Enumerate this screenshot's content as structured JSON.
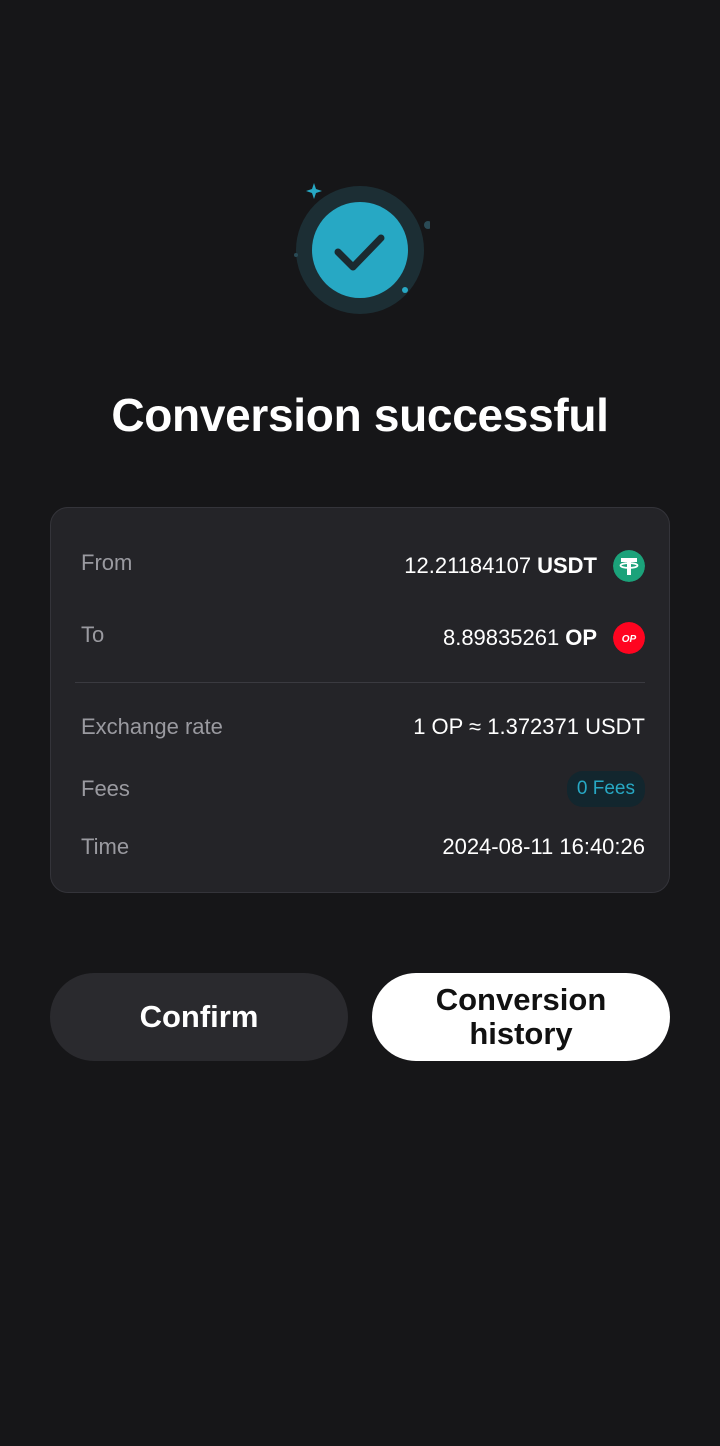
{
  "title": "Conversion successful",
  "colors": {
    "accent": "#27a8c4",
    "usdt": "#1ba27a",
    "op": "#ff0420",
    "background": "#161618",
    "card": "#242428"
  },
  "details": {
    "from": {
      "label": "From",
      "amount": "12.21184107",
      "unit": "USDT",
      "icon": "usdt-icon"
    },
    "to": {
      "label": "To",
      "amount": "8.89835261",
      "unit": "OP",
      "icon": "op-icon",
      "icon_text": "OP"
    },
    "exchange_rate": {
      "label": "Exchange rate",
      "value": "1 OP ≈ 1.372371 USDT"
    },
    "fees": {
      "label": "Fees",
      "value": "0 Fees"
    },
    "time": {
      "label": "Time",
      "value": "2024-08-11 16:40:26"
    }
  },
  "buttons": {
    "confirm": "Confirm",
    "history": "Conversion history"
  }
}
